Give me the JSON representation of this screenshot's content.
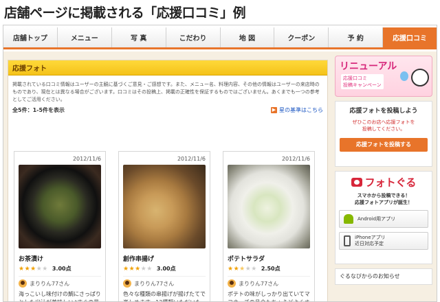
{
  "heading": "店舗ページに掲載される「応援口コミ」例",
  "nav": {
    "tabs": [
      "店舗トップ",
      "メニュー",
      "写 真",
      "こだわり",
      "地 図",
      "クーポン",
      "予 約",
      "応援口コミ"
    ],
    "active_index": 7
  },
  "colors": {
    "accent": "#e8742a",
    "section_bar": "#f4c21a",
    "link": "#1a55c2"
  },
  "main": {
    "section_title": "応援フォト",
    "description": "掲載されている口コミ情報はユーザーの主観に基づくご意見・ご感想です。また、メニュー名、料理内容、その他の情報はユーザーの来店時のものであり、現在とは異なる場合がございます。口コミはその投稿上、掲載の正確性を保証するものではございません。あくまでも一つの参考としてご活用ください。",
    "count": "全5件：1-5件を表示",
    "rules_link": "星の基準はこちら",
    "cards": [
      {
        "date": "2012/11/6",
        "title": "お茶漬け",
        "rating": 3,
        "score": "3.00点",
        "user": "まりりん77さん",
        "comment": "海っこいし味付けの鯛にさっぱりとした出汁が美味しい♪すぐの量なので意外に"
      },
      {
        "date": "2012/11/6",
        "title": "創作串揚げ",
        "rating": 3,
        "score": "3.00点",
        "user": "まりりん77さん",
        "comment": "色々な種類の串揚げが揚げたてで楽しめます。12種類いただいたら結構の"
      },
      {
        "date": "2012/11/6",
        "title": "ポテトサラダ",
        "rating": 2.5,
        "score": "2.50点",
        "user": "まりりん77さん",
        "comment": "ポテトの味がしっかり出ていてマヨネーズの具合もちょうどよくさっぱりとサラダ"
      }
    ]
  },
  "side": {
    "banner_title": "リニューアル",
    "banner_sub": "応援口コミ\n投稿キャンペーン",
    "post_title": "応援フォトを投稿しよう",
    "post_sub": "ぜひこのお店へ応援フォトを\n投稿してください。",
    "post_button": "応援フォトを投稿する",
    "foto_logo": "フォトぐる",
    "foto_text": "スマホから投稿できる！\n応援フォトアプリが誕生！",
    "android_label": "Android用アプリ",
    "iphone_label": "iPhoneアプリ\n近日対応予定",
    "news": "ぐるなびからのお知らせ"
  }
}
